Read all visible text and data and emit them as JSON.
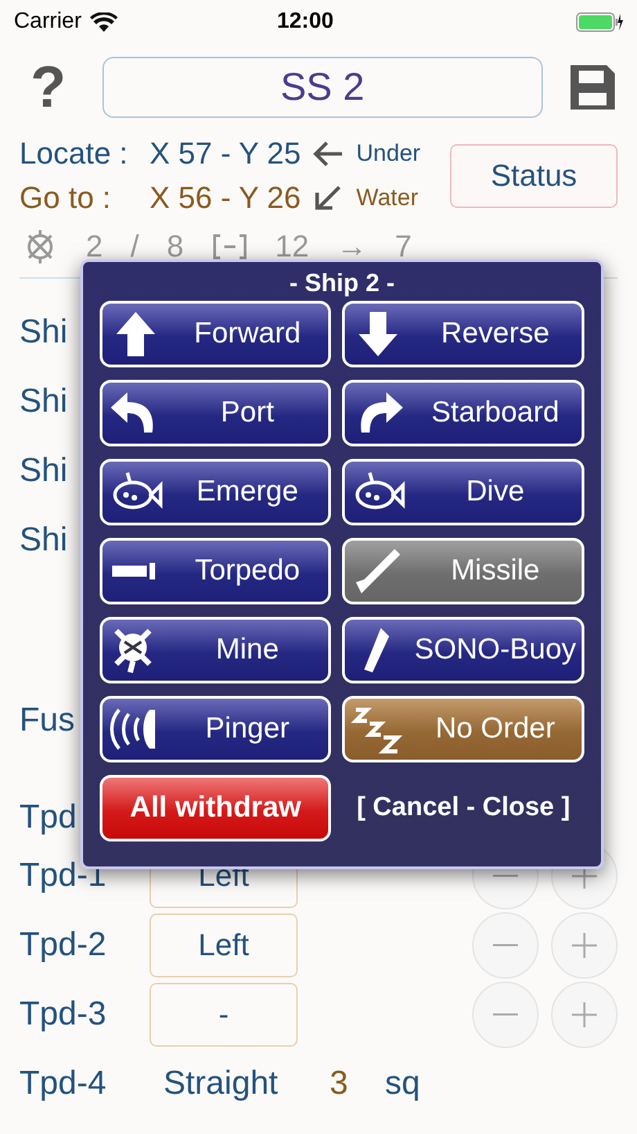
{
  "status_bar": {
    "carrier": "Carrier",
    "time": "12:00"
  },
  "header": {
    "help": "?",
    "title": "SS 2"
  },
  "locate": {
    "label": "Locate :",
    "value": "X 57 - Y 25",
    "note": "Under"
  },
  "goto": {
    "label": "Go to :",
    "value": "X 56 - Y 26",
    "note": "Water"
  },
  "status_button": "Status",
  "stats": [
    "2",
    "/",
    "8",
    "12",
    "→",
    "7"
  ],
  "covered_labels": [
    "Shi",
    "Shi",
    "Shi",
    "Shi",
    "Fus",
    "Tpd"
  ],
  "torpedo_rows": [
    {
      "kind": "box",
      "label": "Tpd-1",
      "value": "Left"
    },
    {
      "kind": "box",
      "label": "Tpd-2",
      "value": "Left"
    },
    {
      "kind": "box",
      "label": "Tpd-3",
      "value": "-"
    },
    {
      "kind": "text",
      "label": "Tpd-4",
      "value": "Straight",
      "number": "3",
      "unit": "sq"
    }
  ],
  "dialog": {
    "title": "- Ship 2 -",
    "orders": [
      {
        "label": "Forward",
        "disabled": false,
        "selected": false
      },
      {
        "label": "Reverse",
        "disabled": false,
        "selected": false
      },
      {
        "label": "Port",
        "disabled": false,
        "selected": false
      },
      {
        "label": "Starboard",
        "disabled": false,
        "selected": false
      },
      {
        "label": "Emerge",
        "disabled": false,
        "selected": false
      },
      {
        "label": "Dive",
        "disabled": false,
        "selected": false
      },
      {
        "label": "Torpedo",
        "disabled": false,
        "selected": false
      },
      {
        "label": "Missile",
        "disabled": true,
        "selected": false
      },
      {
        "label": "Mine",
        "disabled": false,
        "selected": false
      },
      {
        "label": "SONO-Buoy",
        "disabled": false,
        "selected": false
      },
      {
        "label": "Pinger",
        "disabled": false,
        "selected": false
      },
      {
        "label": "No Order",
        "disabled": false,
        "selected": true
      }
    ],
    "withdraw": "All withdraw",
    "cancel": "[ Cancel - Close ]"
  }
}
